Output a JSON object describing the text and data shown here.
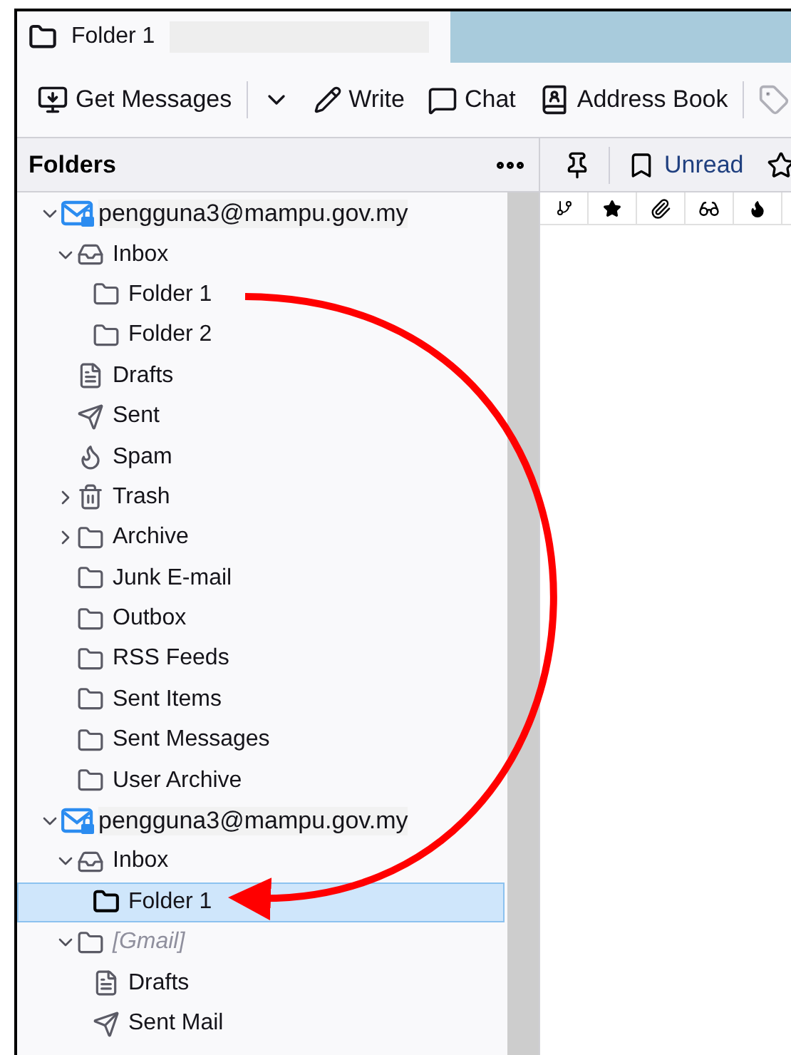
{
  "tab": {
    "title": "Folder 1",
    "selected": true
  },
  "toolbar": {
    "buttons": [
      {
        "kind": "get",
        "label": "Get Messages"
      },
      {
        "kind": "menu"
      },
      {
        "kind": "write",
        "label": "Write"
      },
      {
        "kind": "chat",
        "label": "Chat"
      },
      {
        "kind": "addressbook",
        "label": "Address Book"
      },
      {
        "kind": "tag"
      }
    ]
  },
  "folder_pane": {
    "title": "Folders"
  },
  "tree": [
    {
      "kind": "account",
      "name": "pengguna3@mampu.gov.my",
      "expanded": true,
      "selected": false,
      "children": [
        {
          "kind": "inbox",
          "name": "Inbox",
          "expanded": true,
          "selected": false,
          "children": [
            {
              "kind": "folder",
              "name": "Folder 1",
              "selected": false
            },
            {
              "kind": "folder",
              "name": "Folder 2",
              "selected": false
            }
          ]
        },
        {
          "kind": "drafts",
          "name": "Drafts",
          "selected": false
        },
        {
          "kind": "sent",
          "name": "Sent",
          "selected": false
        },
        {
          "kind": "spam",
          "name": "Spam",
          "selected": false
        },
        {
          "kind": "trash",
          "name": "Trash",
          "expanded": false,
          "selected": false
        },
        {
          "kind": "folder",
          "name": "Archive",
          "expanded": false,
          "selected": false
        },
        {
          "kind": "folder",
          "name": "Junk E-mail",
          "selected": false
        },
        {
          "kind": "folder",
          "name": "Outbox",
          "selected": false
        },
        {
          "kind": "folder",
          "name": "RSS Feeds",
          "selected": false
        },
        {
          "kind": "folder",
          "name": "Sent Items",
          "selected": false
        },
        {
          "kind": "folder",
          "name": "Sent Messages",
          "selected": false
        },
        {
          "kind": "folder",
          "name": "User Archive",
          "selected": false
        }
      ]
    },
    {
      "kind": "account",
      "name": "pengguna3@mampu.gov.my",
      "expanded": true,
      "selected": false,
      "children": [
        {
          "kind": "inbox",
          "name": "Inbox",
          "expanded": true,
          "selected": false,
          "children": [
            {
              "kind": "folder",
              "name": "Folder 1",
              "selected": true
            }
          ]
        },
        {
          "kind": "folder",
          "name": "[Gmail]",
          "expanded": true,
          "selected": false,
          "dimmed": true,
          "children": [
            {
              "kind": "drafts",
              "name": "Drafts",
              "selected": false
            },
            {
              "kind": "sent",
              "name": "Sent Mail",
              "selected": false
            }
          ]
        }
      ]
    }
  ],
  "quick_filter": {
    "buttons": [
      {
        "kind": "pin"
      },
      {
        "kind": "unread",
        "label": "Unread"
      },
      {
        "kind": "star"
      }
    ]
  },
  "columns": [
    {
      "kind": "thread"
    },
    {
      "kind": "star"
    },
    {
      "kind": "attachment"
    },
    {
      "kind": "read"
    },
    {
      "kind": "junk"
    }
  ]
}
